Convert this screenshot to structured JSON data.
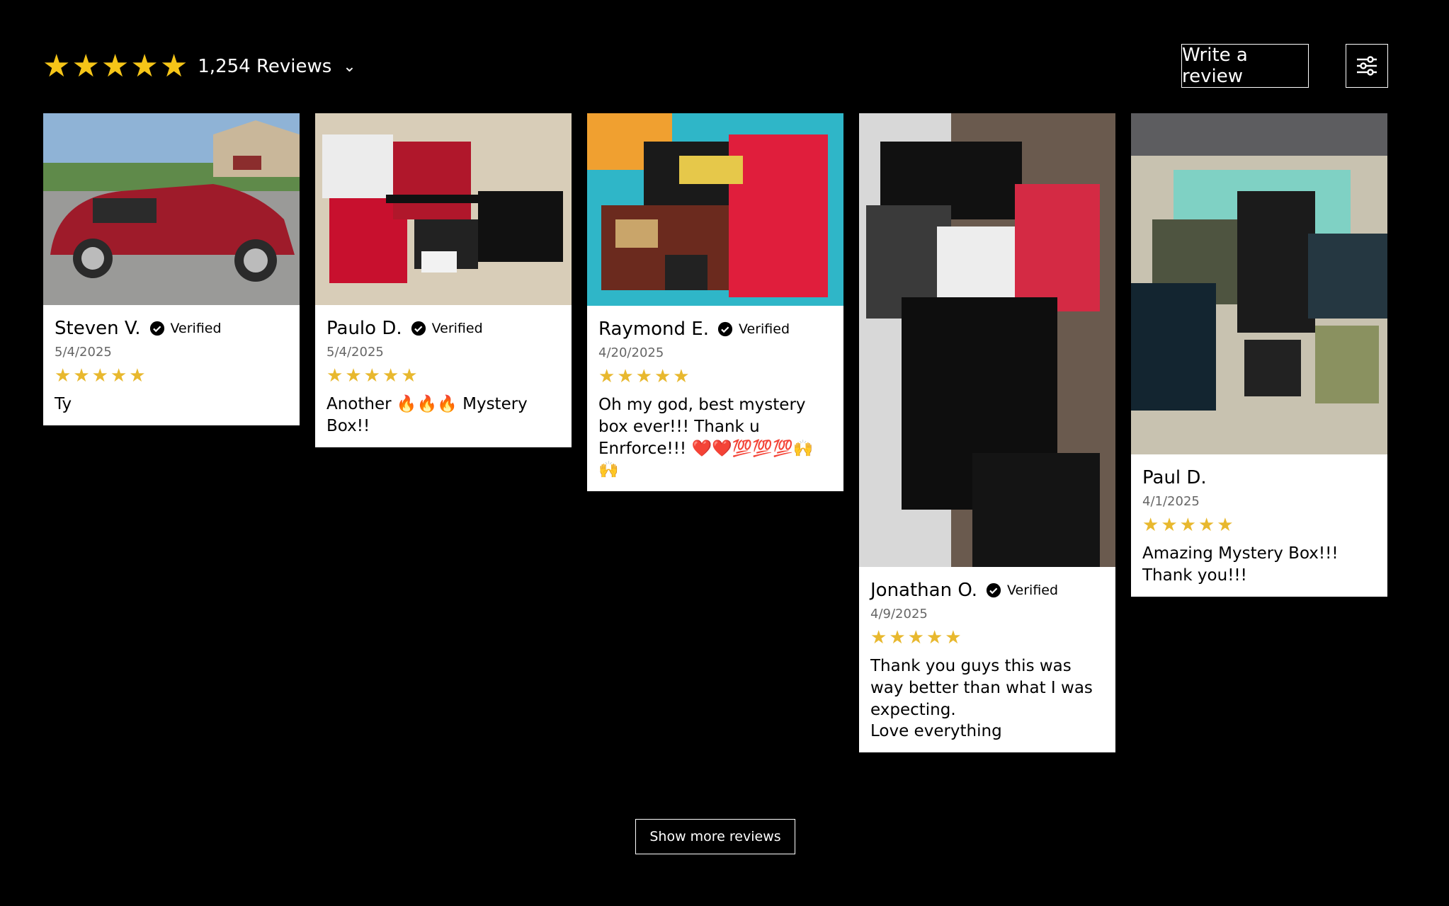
{
  "summary": {
    "stars": [
      "★",
      "★",
      "★",
      "★",
      "★"
    ],
    "count_label": "1,254 Reviews",
    "chevron": "⌄",
    "star_color": "#f5c518"
  },
  "actions": {
    "write_review_label": "Write a review",
    "filter_icon": "sliders-icon"
  },
  "reviews": [
    {
      "name": "Steven V.",
      "verified": "Verified",
      "date": "5/4/2025",
      "stars": [
        "★",
        "★",
        "★",
        "★",
        "★"
      ],
      "text": "Ty"
    },
    {
      "name": "Paulo D.",
      "verified": "Verified",
      "date": "5/4/2025",
      "stars": [
        "★",
        "★",
        "★",
        "★",
        "★"
      ],
      "text": "Another 🔥🔥🔥 Mystery Box!!"
    },
    {
      "name": "Raymond E.",
      "verified": "Verified",
      "date": "4/20/2025",
      "stars": [
        "★",
        "★",
        "★",
        "★",
        "★"
      ],
      "text": "Oh my god, best mystery box ever!!! Thank u Enrforce!!! ❤️❤️💯💯💯🙌🙌"
    },
    {
      "name": "Jonathan O.",
      "verified": "Verified",
      "date": "4/9/2025",
      "stars": [
        "★",
        "★",
        "★",
        "★",
        "★"
      ],
      "text": "Thank you guys this was way better than what I was expecting.\nLove everything"
    },
    {
      "name": "Paul D.",
      "date": "4/1/2025",
      "stars": [
        "★",
        "★",
        "★",
        "★",
        "★"
      ],
      "text": "Amazing Mystery Box!!! Thank you!!!"
    }
  ],
  "show_more_label": "Show more reviews"
}
